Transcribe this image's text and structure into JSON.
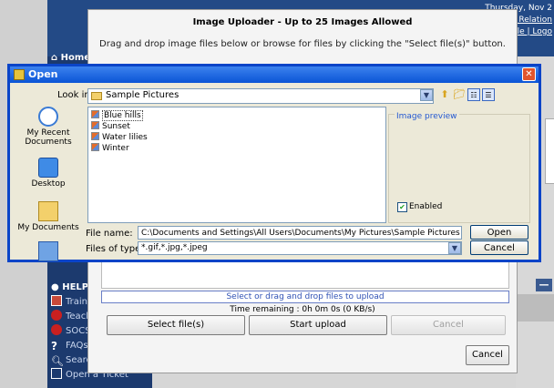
{
  "background": {
    "date_text": "Thursday, Nov 2",
    "link_1": "ent Relation",
    "link_2": "ofile | Logo",
    "nav_home": "Home",
    "nav_section": "HELP C",
    "nav_items": [
      {
        "label": "Trainin",
        "icon": "training-icon"
      },
      {
        "label": "Teach",
        "icon": "apple-icon"
      },
      {
        "label": "SOCS",
        "icon": "apple-icon"
      },
      {
        "label": "FAQs",
        "icon": "question-icon"
      },
      {
        "label": "Search",
        "icon": "magnifier-icon"
      },
      {
        "label": "Open a Ticket",
        "icon": "ticket-icon"
      }
    ],
    "minimize_glyph": "—"
  },
  "uploader": {
    "title": "Image Uploader - Up to 25 Images Allowed",
    "instructions": "Drag and drop image files below or browse for files by clicking the \"Select file(s)\" button.",
    "status": "Select or drag and drop files to upload",
    "time_remaining": "Time remaining : 0h 0m 0s (0 KB/s)",
    "select_button": "Select file(s)",
    "start_button": "Start upload",
    "cancel_upload_button": "Cancel",
    "cancel_button": "Cancel"
  },
  "dialog": {
    "title": "Open",
    "close_glyph": "✕",
    "look_in_label": "Look in:",
    "look_in_value": "Sample Pictures",
    "places": [
      {
        "label": "My Recent Documents"
      },
      {
        "label": "Desktop"
      },
      {
        "label": "My Documents"
      }
    ],
    "files": [
      "Blue hills",
      "Sunset",
      "Water lilies",
      "Winter"
    ],
    "preview_label": "Image preview",
    "enabled_label": "Enabled",
    "enabled_checked": true,
    "file_name_label": "File name:",
    "file_name_value": "C:\\Documents and Settings\\All Users\\Documents\\My Pictures\\Sample Pictures",
    "file_type_label": "Files of type:",
    "file_type_value": "*.gif,*.jpg,*.jpeg",
    "open_button": "Open",
    "cancel_button": "Cancel"
  },
  "colors": {
    "titlebar": "#0a54d6",
    "dialog_bg": "#ece9d8",
    "nav_bg": "#1c3a6e"
  }
}
